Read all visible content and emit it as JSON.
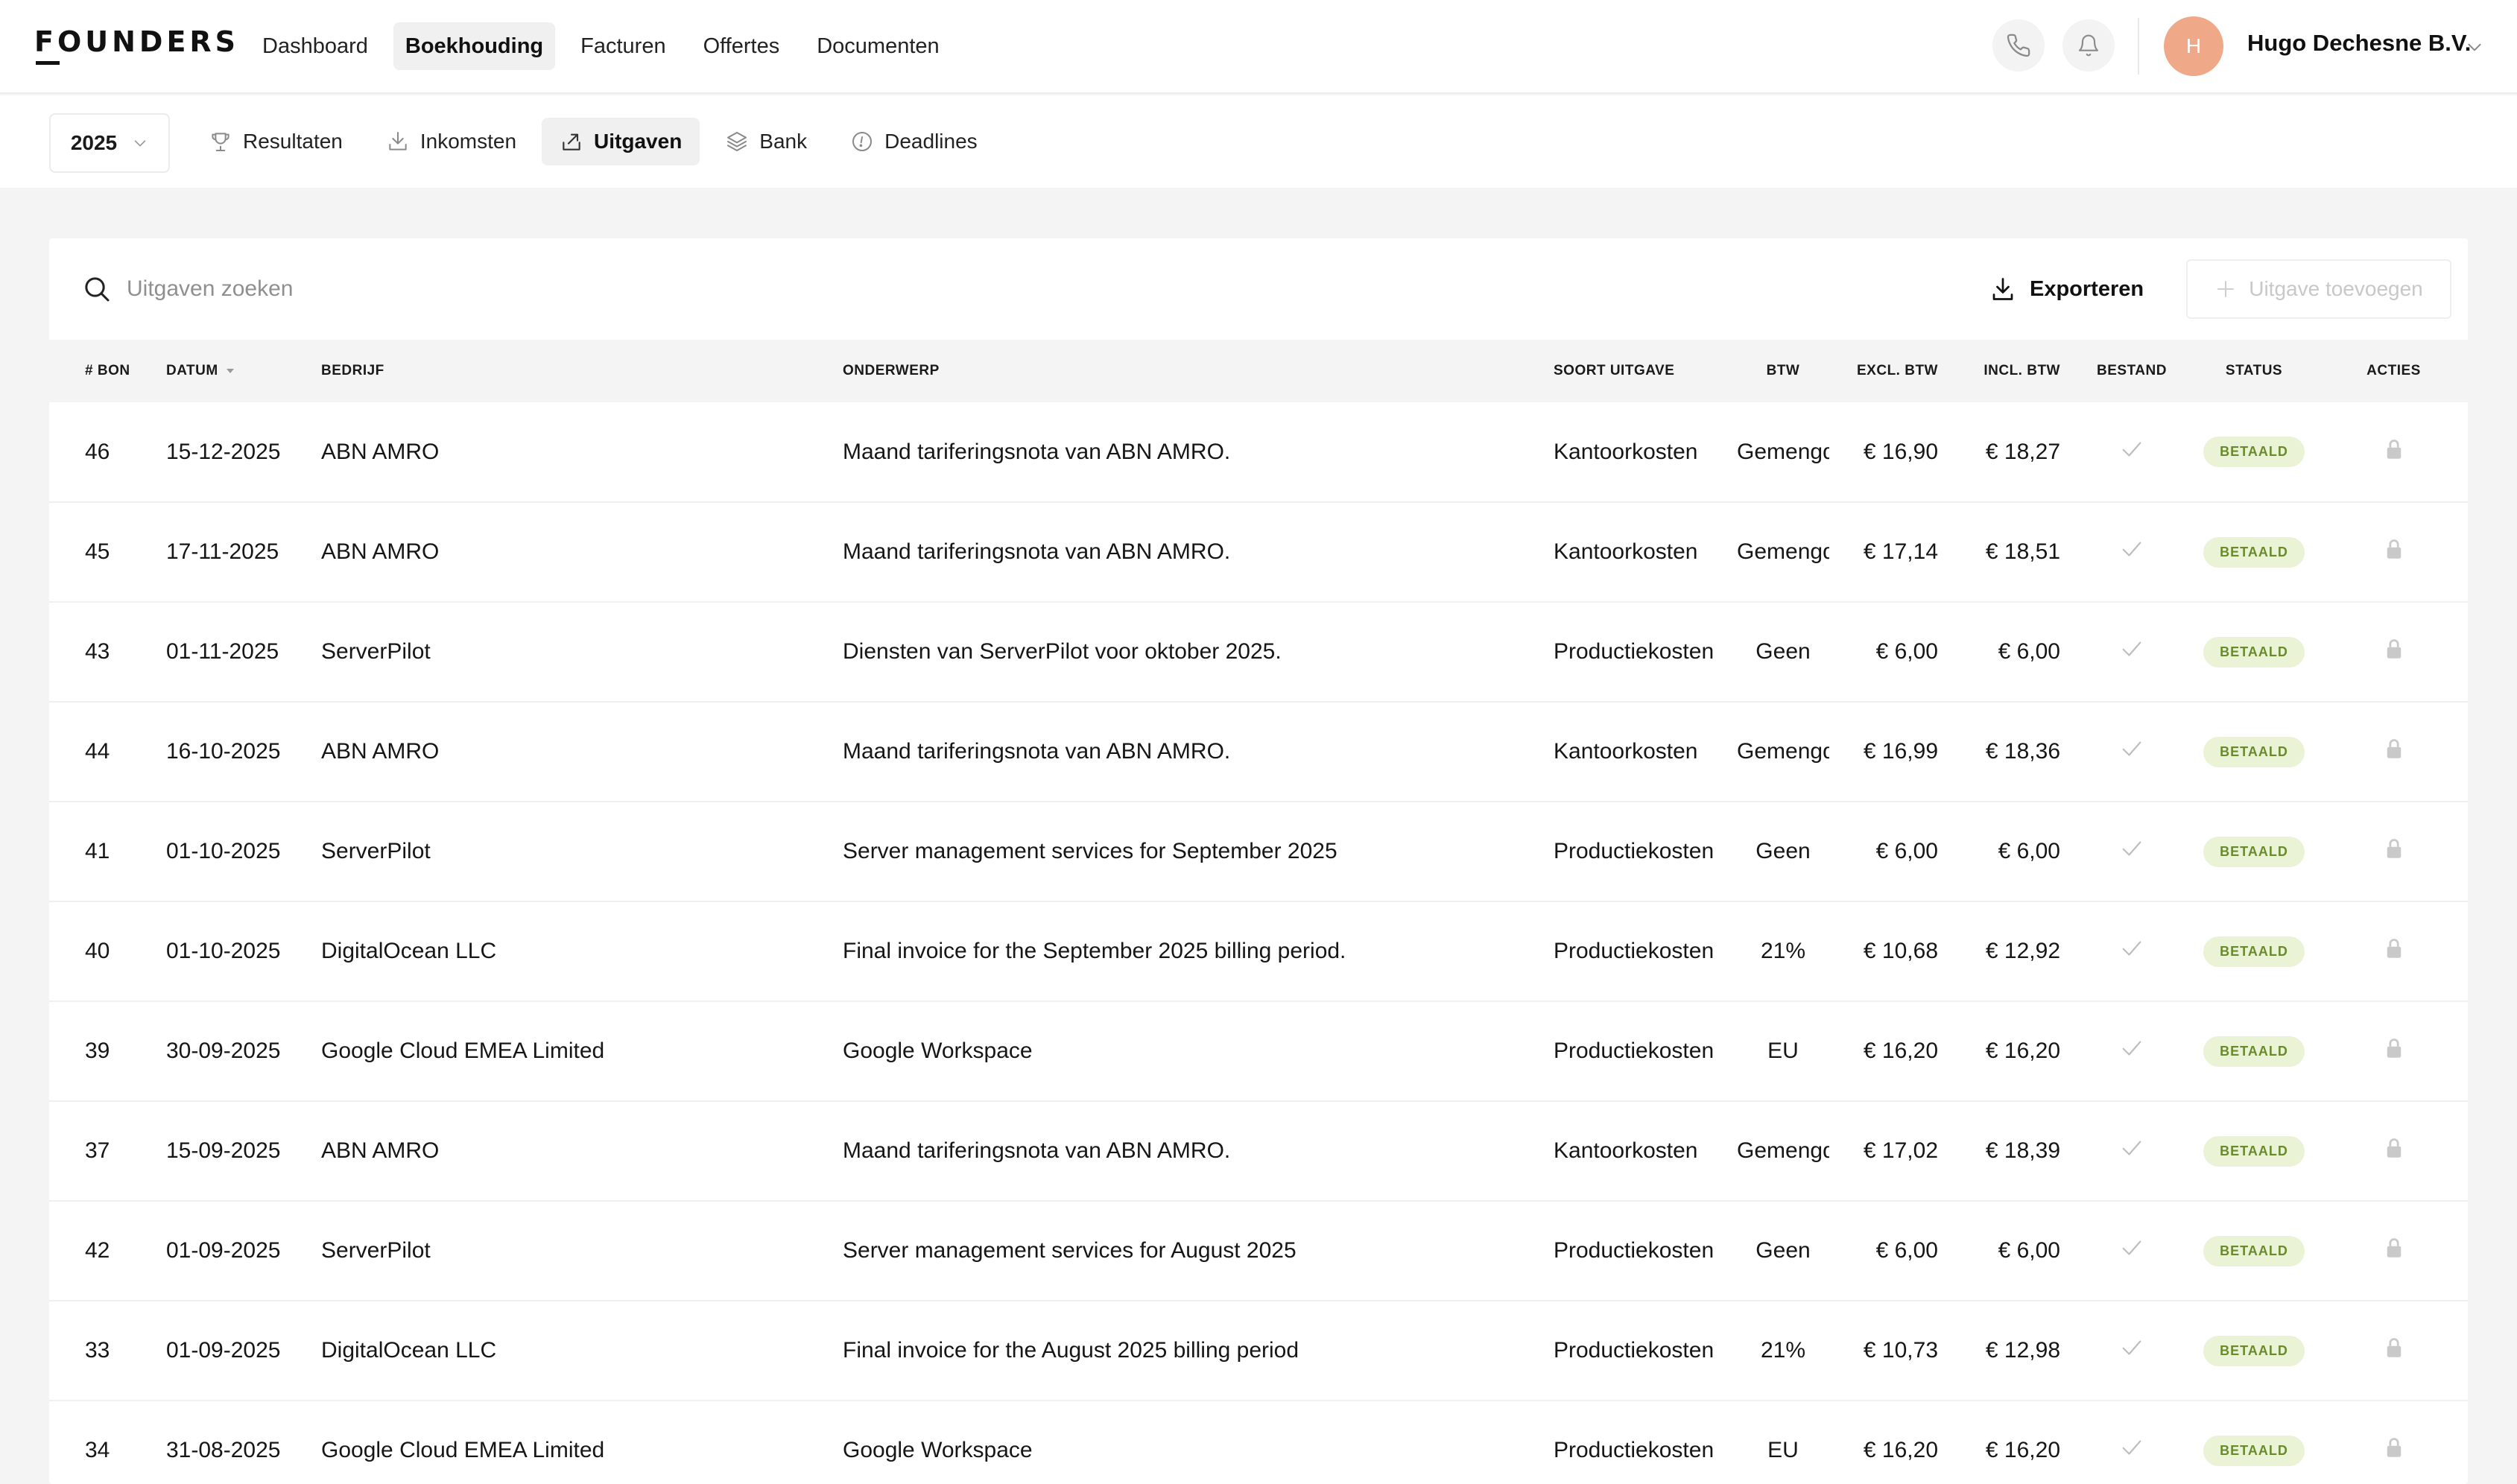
{
  "brand": {
    "logo_text": "FOUNDERS"
  },
  "mainnav": {
    "items": [
      {
        "label": "Dashboard",
        "active": false
      },
      {
        "label": "Boekhouding",
        "active": true
      },
      {
        "label": "Facturen",
        "active": false
      },
      {
        "label": "Offertes",
        "active": false
      },
      {
        "label": "Documenten",
        "active": false
      }
    ]
  },
  "header": {
    "phone_icon": "phone-icon",
    "bell_icon": "bell-icon",
    "avatar_initial": "H",
    "company_name": "Hugo Dechesne B.V.",
    "avatar_color": "#f0a988"
  },
  "subnav": {
    "year": "2025",
    "tabs": [
      {
        "label": "Resultaten",
        "icon": "trophy-icon",
        "active": false
      },
      {
        "label": "Inkomsten",
        "icon": "inbox-download-icon",
        "active": false
      },
      {
        "label": "Uitgaven",
        "icon": "share-out-icon",
        "active": true
      },
      {
        "label": "Bank",
        "icon": "layers-icon",
        "active": false
      },
      {
        "label": "Deadlines",
        "icon": "alert-circle-icon",
        "active": false
      }
    ]
  },
  "toolbar": {
    "search_placeholder": "Uitgaven zoeken",
    "export_label": "Exporteren",
    "add_label": "Uitgave toevoegen"
  },
  "table": {
    "headers": {
      "bon": "# BON",
      "datum": "DATUM",
      "bedrijf": "BEDRIJF",
      "onderwerp": "ONDERWERP",
      "soort": "SOORT UITGAVE",
      "btw": "BTW",
      "excl": "EXCL. BTW",
      "incl": "INCL. BTW",
      "bestand": "BESTAND",
      "status": "STATUS",
      "acties": "ACTIES"
    },
    "rows": [
      {
        "bon": "46",
        "datum": "15-12-2025",
        "bedrijf": "ABN AMRO",
        "onderwerp": "Maand tariferingsnota van ABN AMRO.",
        "soort": "Kantoorkosten",
        "btw": "Gemengd",
        "excl": "€ 16,90",
        "incl": "€ 18,27",
        "status": "BETAALD"
      },
      {
        "bon": "45",
        "datum": "17-11-2025",
        "bedrijf": "ABN AMRO",
        "onderwerp": "Maand tariferingsnota van ABN AMRO.",
        "soort": "Kantoorkosten",
        "btw": "Gemengd",
        "excl": "€ 17,14",
        "incl": "€ 18,51",
        "status": "BETAALD"
      },
      {
        "bon": "43",
        "datum": "01-11-2025",
        "bedrijf": "ServerPilot",
        "onderwerp": "Diensten van ServerPilot voor oktober 2025.",
        "soort": "Productiekosten",
        "btw": "Geen",
        "excl": "€ 6,00",
        "incl": "€ 6,00",
        "status": "BETAALD"
      },
      {
        "bon": "44",
        "datum": "16-10-2025",
        "bedrijf": "ABN AMRO",
        "onderwerp": "Maand tariferingsnota van ABN AMRO.",
        "soort": "Kantoorkosten",
        "btw": "Gemengd",
        "excl": "€ 16,99",
        "incl": "€ 18,36",
        "status": "BETAALD"
      },
      {
        "bon": "41",
        "datum": "01-10-2025",
        "bedrijf": "ServerPilot",
        "onderwerp": "Server management services for September 2025",
        "soort": "Productiekosten",
        "btw": "Geen",
        "excl": "€ 6,00",
        "incl": "€ 6,00",
        "status": "BETAALD"
      },
      {
        "bon": "40",
        "datum": "01-10-2025",
        "bedrijf": "DigitalOcean LLC",
        "onderwerp": "Final invoice for the September 2025 billing period.",
        "soort": "Productiekosten",
        "btw": "21%",
        "excl": "€ 10,68",
        "incl": "€ 12,92",
        "status": "BETAALD"
      },
      {
        "bon": "39",
        "datum": "30-09-2025",
        "bedrijf": "Google Cloud EMEA Limited",
        "onderwerp": "Google Workspace",
        "soort": "Productiekosten",
        "btw": "EU",
        "excl": "€ 16,20",
        "incl": "€ 16,20",
        "status": "BETAALD"
      },
      {
        "bon": "37",
        "datum": "15-09-2025",
        "bedrijf": "ABN AMRO",
        "onderwerp": "Maand tariferingsnota van ABN AMRO.",
        "soort": "Kantoorkosten",
        "btw": "Gemengd",
        "excl": "€ 17,02",
        "incl": "€ 18,39",
        "status": "BETAALD"
      },
      {
        "bon": "42",
        "datum": "01-09-2025",
        "bedrijf": "ServerPilot",
        "onderwerp": "Server management services for August 2025",
        "soort": "Productiekosten",
        "btw": "Geen",
        "excl": "€ 6,00",
        "incl": "€ 6,00",
        "status": "BETAALD"
      },
      {
        "bon": "33",
        "datum": "01-09-2025",
        "bedrijf": "DigitalOcean LLC",
        "onderwerp": "Final invoice for the August 2025 billing period",
        "soort": "Productiekosten",
        "btw": "21%",
        "excl": "€ 10,73",
        "incl": "€ 12,98",
        "status": "BETAALD"
      },
      {
        "bon": "34",
        "datum": "31-08-2025",
        "bedrijf": "Google Cloud EMEA Limited",
        "onderwerp": "Google Workspace",
        "soort": "Productiekosten",
        "btw": "EU",
        "excl": "€ 16,20",
        "incl": "€ 16,20",
        "status": "BETAALD"
      }
    ]
  },
  "colors": {
    "badge_bg": "#eaf3d6",
    "badge_text": "#6a8a2e",
    "active_tab_bg": "#f0f0f0"
  }
}
